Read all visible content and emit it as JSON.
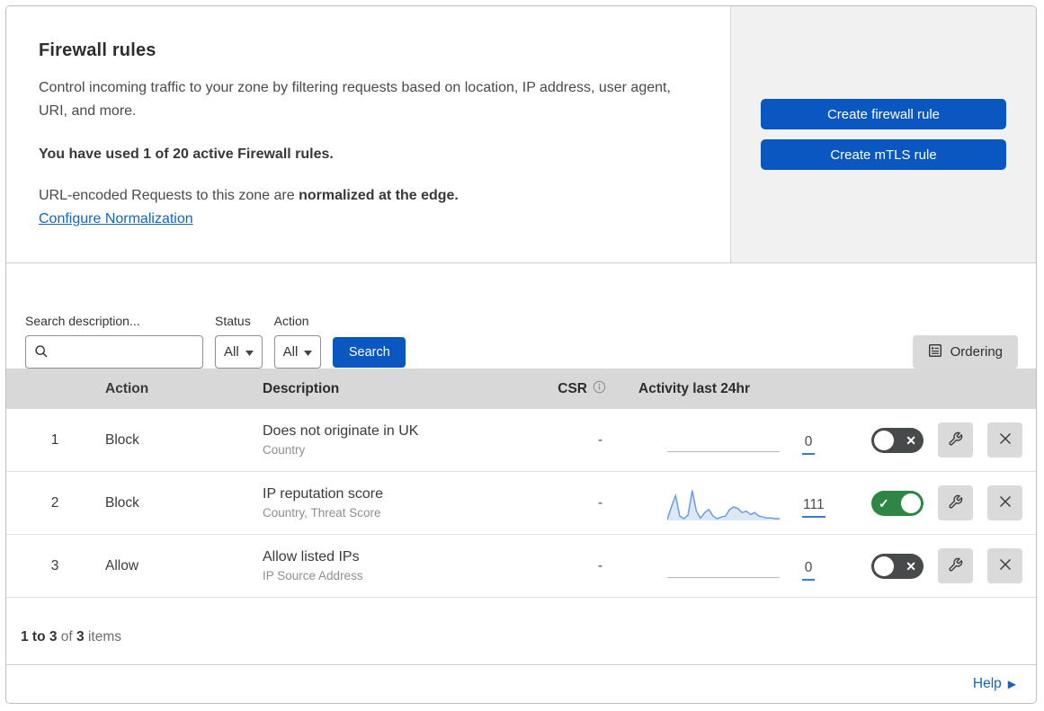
{
  "header": {
    "title": "Firewall rules",
    "description": "Control incoming traffic to your zone by filtering requests based on location, IP address, user agent, URI, and more.",
    "usage_statement": "You have used 1 of 20 active Firewall rules.",
    "normalization_text": "URL-encoded Requests to this zone are ",
    "normalization_bold": "normalized at the edge.",
    "normalization_link": "Configure Normalization",
    "create_firewall_button": "Create firewall rule",
    "create_mtls_button": "Create mTLS rule"
  },
  "filters": {
    "search_label": "Search description...",
    "status_label": "Status",
    "status_value": "All",
    "action_label": "Action",
    "action_value": "All",
    "search_button": "Search",
    "ordering_button": "Ordering"
  },
  "table": {
    "columns": {
      "action": "Action",
      "description": "Description",
      "csr": "CSR",
      "activity": "Activity last 24hr"
    },
    "rows": [
      {
        "index": "1",
        "action": "Block",
        "description": "Does not originate in UK",
        "criteria": "Country",
        "csr": "-",
        "activity_count": "0",
        "enabled": false,
        "has_sparkline": false
      },
      {
        "index": "2",
        "action": "Block",
        "description": "IP reputation score",
        "criteria": "Country, Threat Score",
        "csr": "-",
        "activity_count": "111",
        "enabled": true,
        "has_sparkline": true
      },
      {
        "index": "3",
        "action": "Allow",
        "description": "Allow listed IPs",
        "criteria": "IP Source Address",
        "csr": "-",
        "activity_count": "0",
        "enabled": false,
        "has_sparkline": false
      }
    ]
  },
  "footer": {
    "range_bold": "1 to 3",
    "of_text": " of ",
    "total_bold": "3",
    "items_text": " items",
    "help_label": "Help"
  },
  "colors": {
    "primary_blue": "#0b57c2",
    "link_blue": "#1465bd",
    "toggle_on_green": "#2d8644",
    "toggle_off_gray": "#474a4b",
    "sparkline_blue": "#6d9be0",
    "sparkline_fill": "#dce8f8"
  },
  "chart_data": {
    "type": "line",
    "title": "Activity last 24hr sparkline (rule 2: IP reputation score)",
    "total_label": "111",
    "x": "24 evenly spaced intervals over last 24 hours",
    "values": [
      0,
      40,
      76,
      11,
      3,
      14,
      92,
      27,
      5,
      22,
      32,
      11,
      3,
      8,
      11,
      32,
      40,
      35,
      22,
      27,
      16,
      22,
      11,
      8,
      5,
      5,
      3,
      3
    ],
    "ylim": [
      0,
      100
    ],
    "grid": false,
    "legend": false
  }
}
